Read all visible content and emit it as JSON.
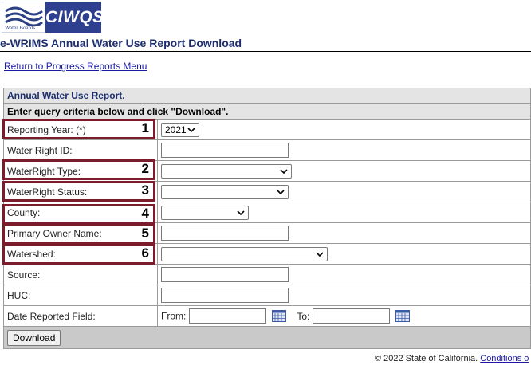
{
  "logo": {
    "small_text": "Water Boards",
    "brand": "CIWQS"
  },
  "page_title": "e-WRIMS Annual Water Use Report Download",
  "return_link": "Return to Progress Reports Menu",
  "form": {
    "header": "Annual Water Use Report.",
    "instructions": "Enter query criteria below and click \"Download\".",
    "rows": [
      {
        "label": "Reporting Year: (*)",
        "control": "select",
        "value": "2021"
      },
      {
        "label": "Water Right ID:",
        "control": "text",
        "value": ""
      },
      {
        "label": "WaterRight Type:",
        "control": "select",
        "value": ""
      },
      {
        "label": "WaterRight Status:",
        "control": "select",
        "value": ""
      },
      {
        "label": "County:",
        "control": "select",
        "value": ""
      },
      {
        "label": "Primary Owner Name:",
        "control": "text",
        "value": ""
      },
      {
        "label": "Watershed:",
        "control": "select",
        "value": ""
      },
      {
        "label": "Source:",
        "control": "text",
        "value": ""
      },
      {
        "label": "HUC:",
        "control": "text",
        "value": ""
      }
    ],
    "date_row": {
      "label": "Date Reported Field:",
      "from_label": "From:",
      "to_label": "To:",
      "from_value": "",
      "to_value": ""
    },
    "download_label": "Download"
  },
  "annotations": [
    "1",
    "2",
    "3",
    "4",
    "5",
    "6"
  ],
  "footer": {
    "copyright": "© 2022 State of California.",
    "link": "Conditions o"
  },
  "colors": {
    "annotation": "#7b1b2c",
    "brand": "#2e3f8f",
    "title": "#1c2e6e"
  }
}
